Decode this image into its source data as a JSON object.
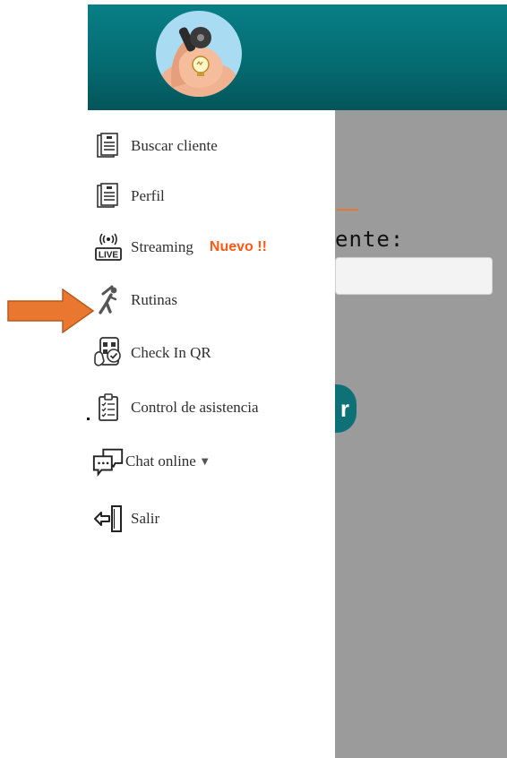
{
  "menu": {
    "items": [
      {
        "label": "Buscar cliente",
        "icon": "document-icon"
      },
      {
        "label": "Perfil",
        "icon": "document-icon"
      },
      {
        "label": "Streaming",
        "icon": "live-broadcast-icon",
        "badge": "Nuevo !!"
      },
      {
        "label": "Rutinas",
        "icon": "exercise-person-icon"
      },
      {
        "label": "Check In QR",
        "icon": "qr-checkin-icon"
      },
      {
        "label": "Control de asistencia",
        "icon": "clipboard-checklist-icon"
      },
      {
        "label": "Chat online",
        "icon": "chat-icon"
      },
      {
        "label": "Salir",
        "icon": "logout-door-icon"
      }
    ]
  },
  "background": {
    "title_fragment": "ente:",
    "button_glyph": "r"
  },
  "colors": {
    "header": "#087f86",
    "badge": "#ff5a16",
    "arrow": "#e9772f",
    "overlay": "#9b9b9b"
  }
}
